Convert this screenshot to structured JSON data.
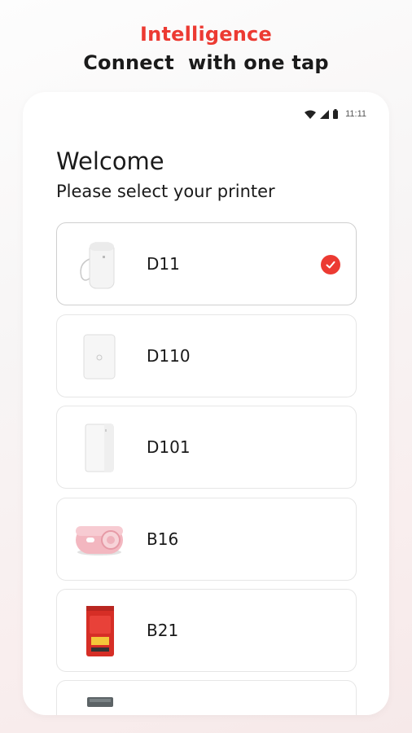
{
  "promo": {
    "headline_accent": "Intelligence",
    "headline_main": "Connect  with one tap"
  },
  "status_bar": {
    "time": "11:11",
    "icons": [
      "wifi-icon",
      "cell-signal-icon",
      "battery-icon"
    ]
  },
  "screen": {
    "title": "Welcome",
    "subtitle": "Please select your printer"
  },
  "printers": [
    {
      "name": "D11",
      "icon": "printer-d11-icon",
      "selected": true
    },
    {
      "name": "D110",
      "icon": "printer-d110-icon",
      "selected": false
    },
    {
      "name": "D101",
      "icon": "printer-d101-icon",
      "selected": false
    },
    {
      "name": "B16",
      "icon": "printer-b16-icon",
      "selected": false
    },
    {
      "name": "B21",
      "icon": "printer-b21-icon",
      "selected": false
    },
    {
      "name": "",
      "icon": "printer-icon",
      "selected": false
    }
  ],
  "colors": {
    "accent": "#ec3a32",
    "text": "#1a1a1a",
    "card_border": "#e6e6e6"
  }
}
